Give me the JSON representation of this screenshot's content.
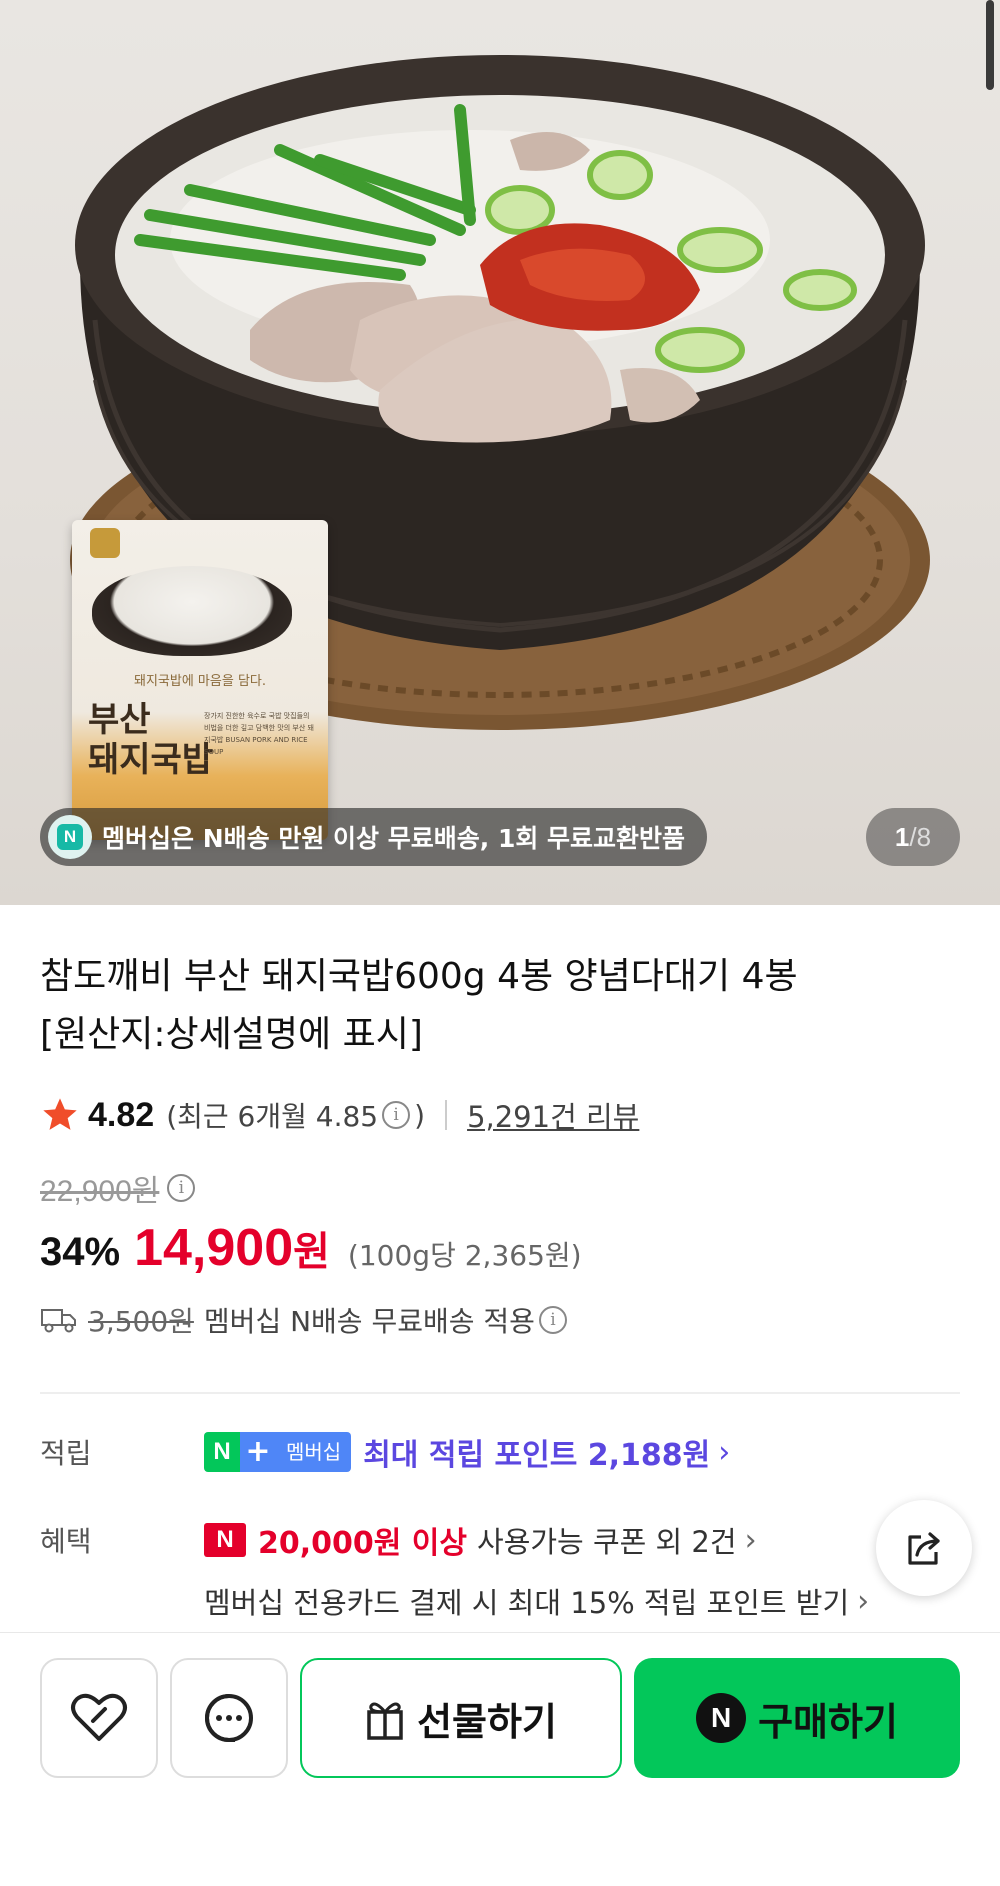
{
  "hero": {
    "promo_badge": "N",
    "promo_text": "멤버십은 N배송 만원 이상 무료배송, 1회 무료교환반품",
    "pager_current": "1",
    "pager_sep": "/",
    "pager_total": "8",
    "package": {
      "slogan": "돼지국밥에 마음을 담다.",
      "name_line1": "부산",
      "name_line2": "돼지국밥",
      "desc": "장가지 진한한 육수로 국밥 맛집들의 비법을 더한 깊고 담백한 맛의 부산 돼지국밥 BUSAN PORK AND RICE SOUP"
    }
  },
  "product": {
    "title_line1": "참도깨비 부산 돼지국밥600g 4봉 양념다대기 4봉",
    "title_line2": "[원산지:상세설명에 표시]",
    "rating": "4.82",
    "recent_rating": "(최근 6개월 4.85",
    "recent_close": ")",
    "reviews": "5,291건 리뷰",
    "original_price": "22,900원",
    "discount_rate": "34%",
    "price": "14,900",
    "price_unit": "원",
    "unit_price": "(100g당 2,365원)",
    "shipping_old": "3,500원",
    "shipping_text": "멤버십 N배송 무료배송 적용"
  },
  "benefits": {
    "point_label": "적립",
    "badge_n": "N",
    "badge_plus": "+",
    "badge_member": "멤버십",
    "point_text": "최대 적립 포인트 2,188원",
    "benefit_label": "혜택",
    "coupon_badge": "N",
    "coupon_amount": "20,000원 이상",
    "coupon_rest": "사용가능 쿠폰 외 2건",
    "card_text": "멤버십 전용카드 결제 시 최대 15% 적립 포인트 받기"
  },
  "bottom_bar": {
    "gift_label": "선물하기",
    "buy_badge": "N",
    "buy_label": "구매하기"
  },
  "colors": {
    "brand_green": "#03c75a",
    "price_red": "#e4002b",
    "point_purple": "#5b47e0"
  },
  "icons": [
    "star-icon",
    "info-icon",
    "truck-icon",
    "chevron-right-icon",
    "share-icon",
    "heart-icon",
    "talk-icon",
    "gift-icon"
  ]
}
